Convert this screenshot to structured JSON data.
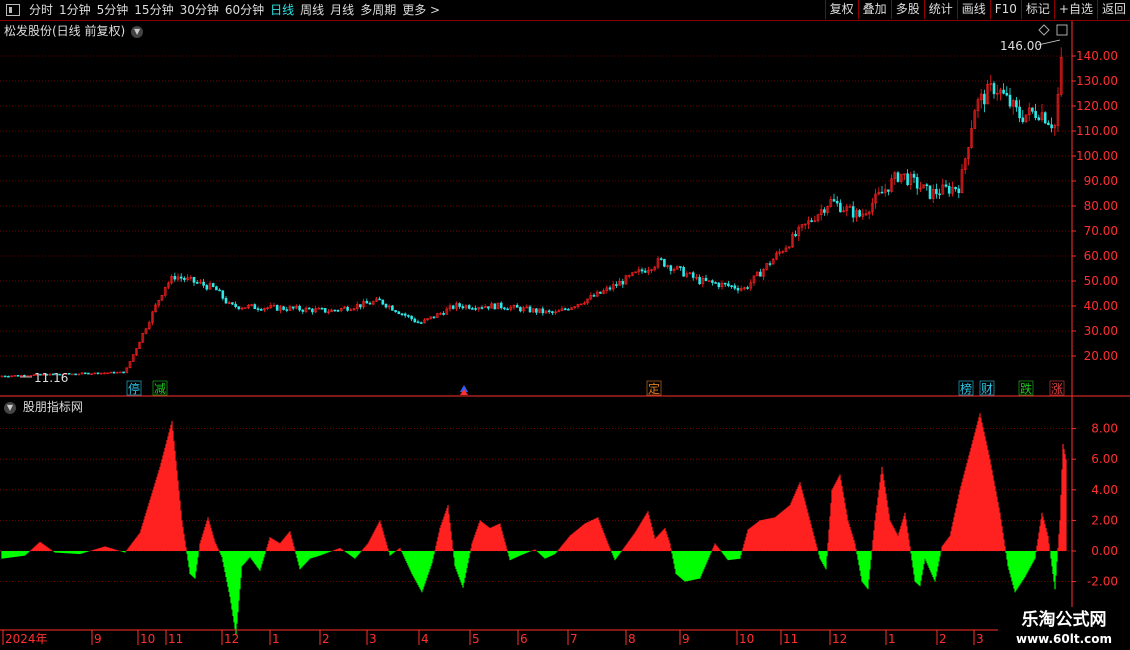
{
  "toolbar": {
    "periods": [
      "分时",
      "1分钟",
      "5分钟",
      "15分钟",
      "30分钟",
      "60分钟",
      "日线",
      "周线",
      "月线",
      "多周期",
      "更多 >"
    ],
    "active_period": "日线",
    "buttons": [
      "复权",
      "叠加",
      "多股",
      "统计",
      "画线",
      "F10",
      "标记",
      "+自选",
      "返回"
    ]
  },
  "main_chart": {
    "title": "松发股份(日线 前复权)",
    "price_axis": [
      "140.00",
      "130.00",
      "120.00",
      "110.00",
      "100.00",
      "90.00",
      "80.00",
      "70.00",
      "60.00",
      "50.00",
      "40.00",
      "30.00",
      "20.00"
    ],
    "high_label": "146.00",
    "low_label": "11.16",
    "markers": [
      {
        "text": "停",
        "color": "#2ec7e8"
      },
      {
        "text": "减",
        "color": "#22c922"
      },
      {
        "text": "定",
        "color": "#e07b22"
      },
      {
        "text": "榜",
        "color": "#2ec7e8"
      },
      {
        "text": "财",
        "color": "#2ec7e8"
      },
      {
        "text": "跌",
        "color": "#22c922"
      },
      {
        "text": "涨",
        "color": "#e04040"
      }
    ]
  },
  "indicator": {
    "title": "股朋指标网",
    "axis": [
      "8.00",
      "6.00",
      "4.00",
      "2.00",
      "0.00",
      "-2.00"
    ]
  },
  "time_axis": [
    "2024年",
    "9",
    "10",
    "11",
    "12",
    "1",
    "2",
    "3",
    "4",
    "5",
    "6",
    "7",
    "8",
    "9",
    "10",
    "11",
    "12",
    "1",
    "2",
    "3"
  ],
  "brand": {
    "name": "乐淘公式网",
    "url": "www.60lt.com"
  },
  "colors": {
    "up": "#ff2020",
    "down": "#00ff00",
    "grid": "#8b0000",
    "axis": "#ff3030",
    "accent": "#2ee8e8"
  }
}
